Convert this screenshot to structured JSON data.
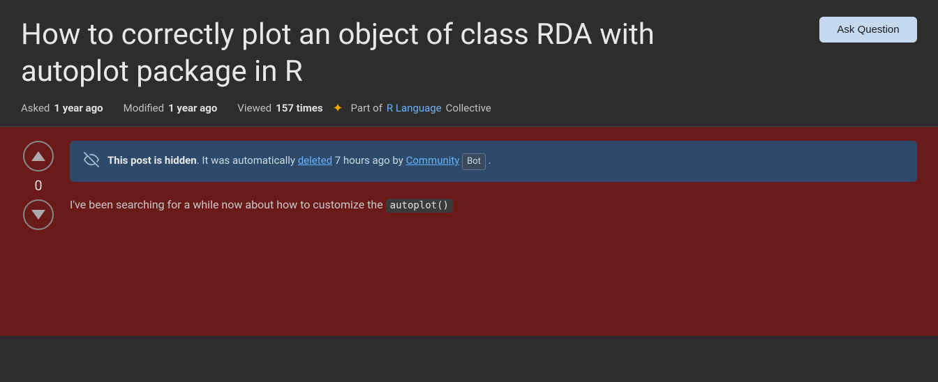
{
  "header": {
    "title": "How to correctly plot an object of class RDA with autoplot package in R",
    "ask_button_label": "Ask Question",
    "meta": {
      "asked_label": "Asked",
      "asked_value": "1 year ago",
      "modified_label": "Modified",
      "modified_value": "1 year ago",
      "viewed_label": "Viewed",
      "viewed_value": "157 times",
      "collective_prefix": "Part of",
      "collective_link_text": "R Language",
      "collective_suffix": "Collective"
    }
  },
  "post": {
    "vote_count": "0",
    "hidden_notice": {
      "text_bold": "This post is hidden",
      "text_main": ". It was automatically ",
      "text_deleted": "deleted",
      "text_when": " 7 hours ago by ",
      "text_community": "Community",
      "text_bot": "Bot",
      "text_period": " ."
    },
    "body_preview": "I've been searching for a while now about how to customize the ",
    "code_snippet": "autoplot()"
  },
  "icons": {
    "vote_up": "▲",
    "vote_down": "▼",
    "hidden": "⊘",
    "collective_star": "✦"
  }
}
